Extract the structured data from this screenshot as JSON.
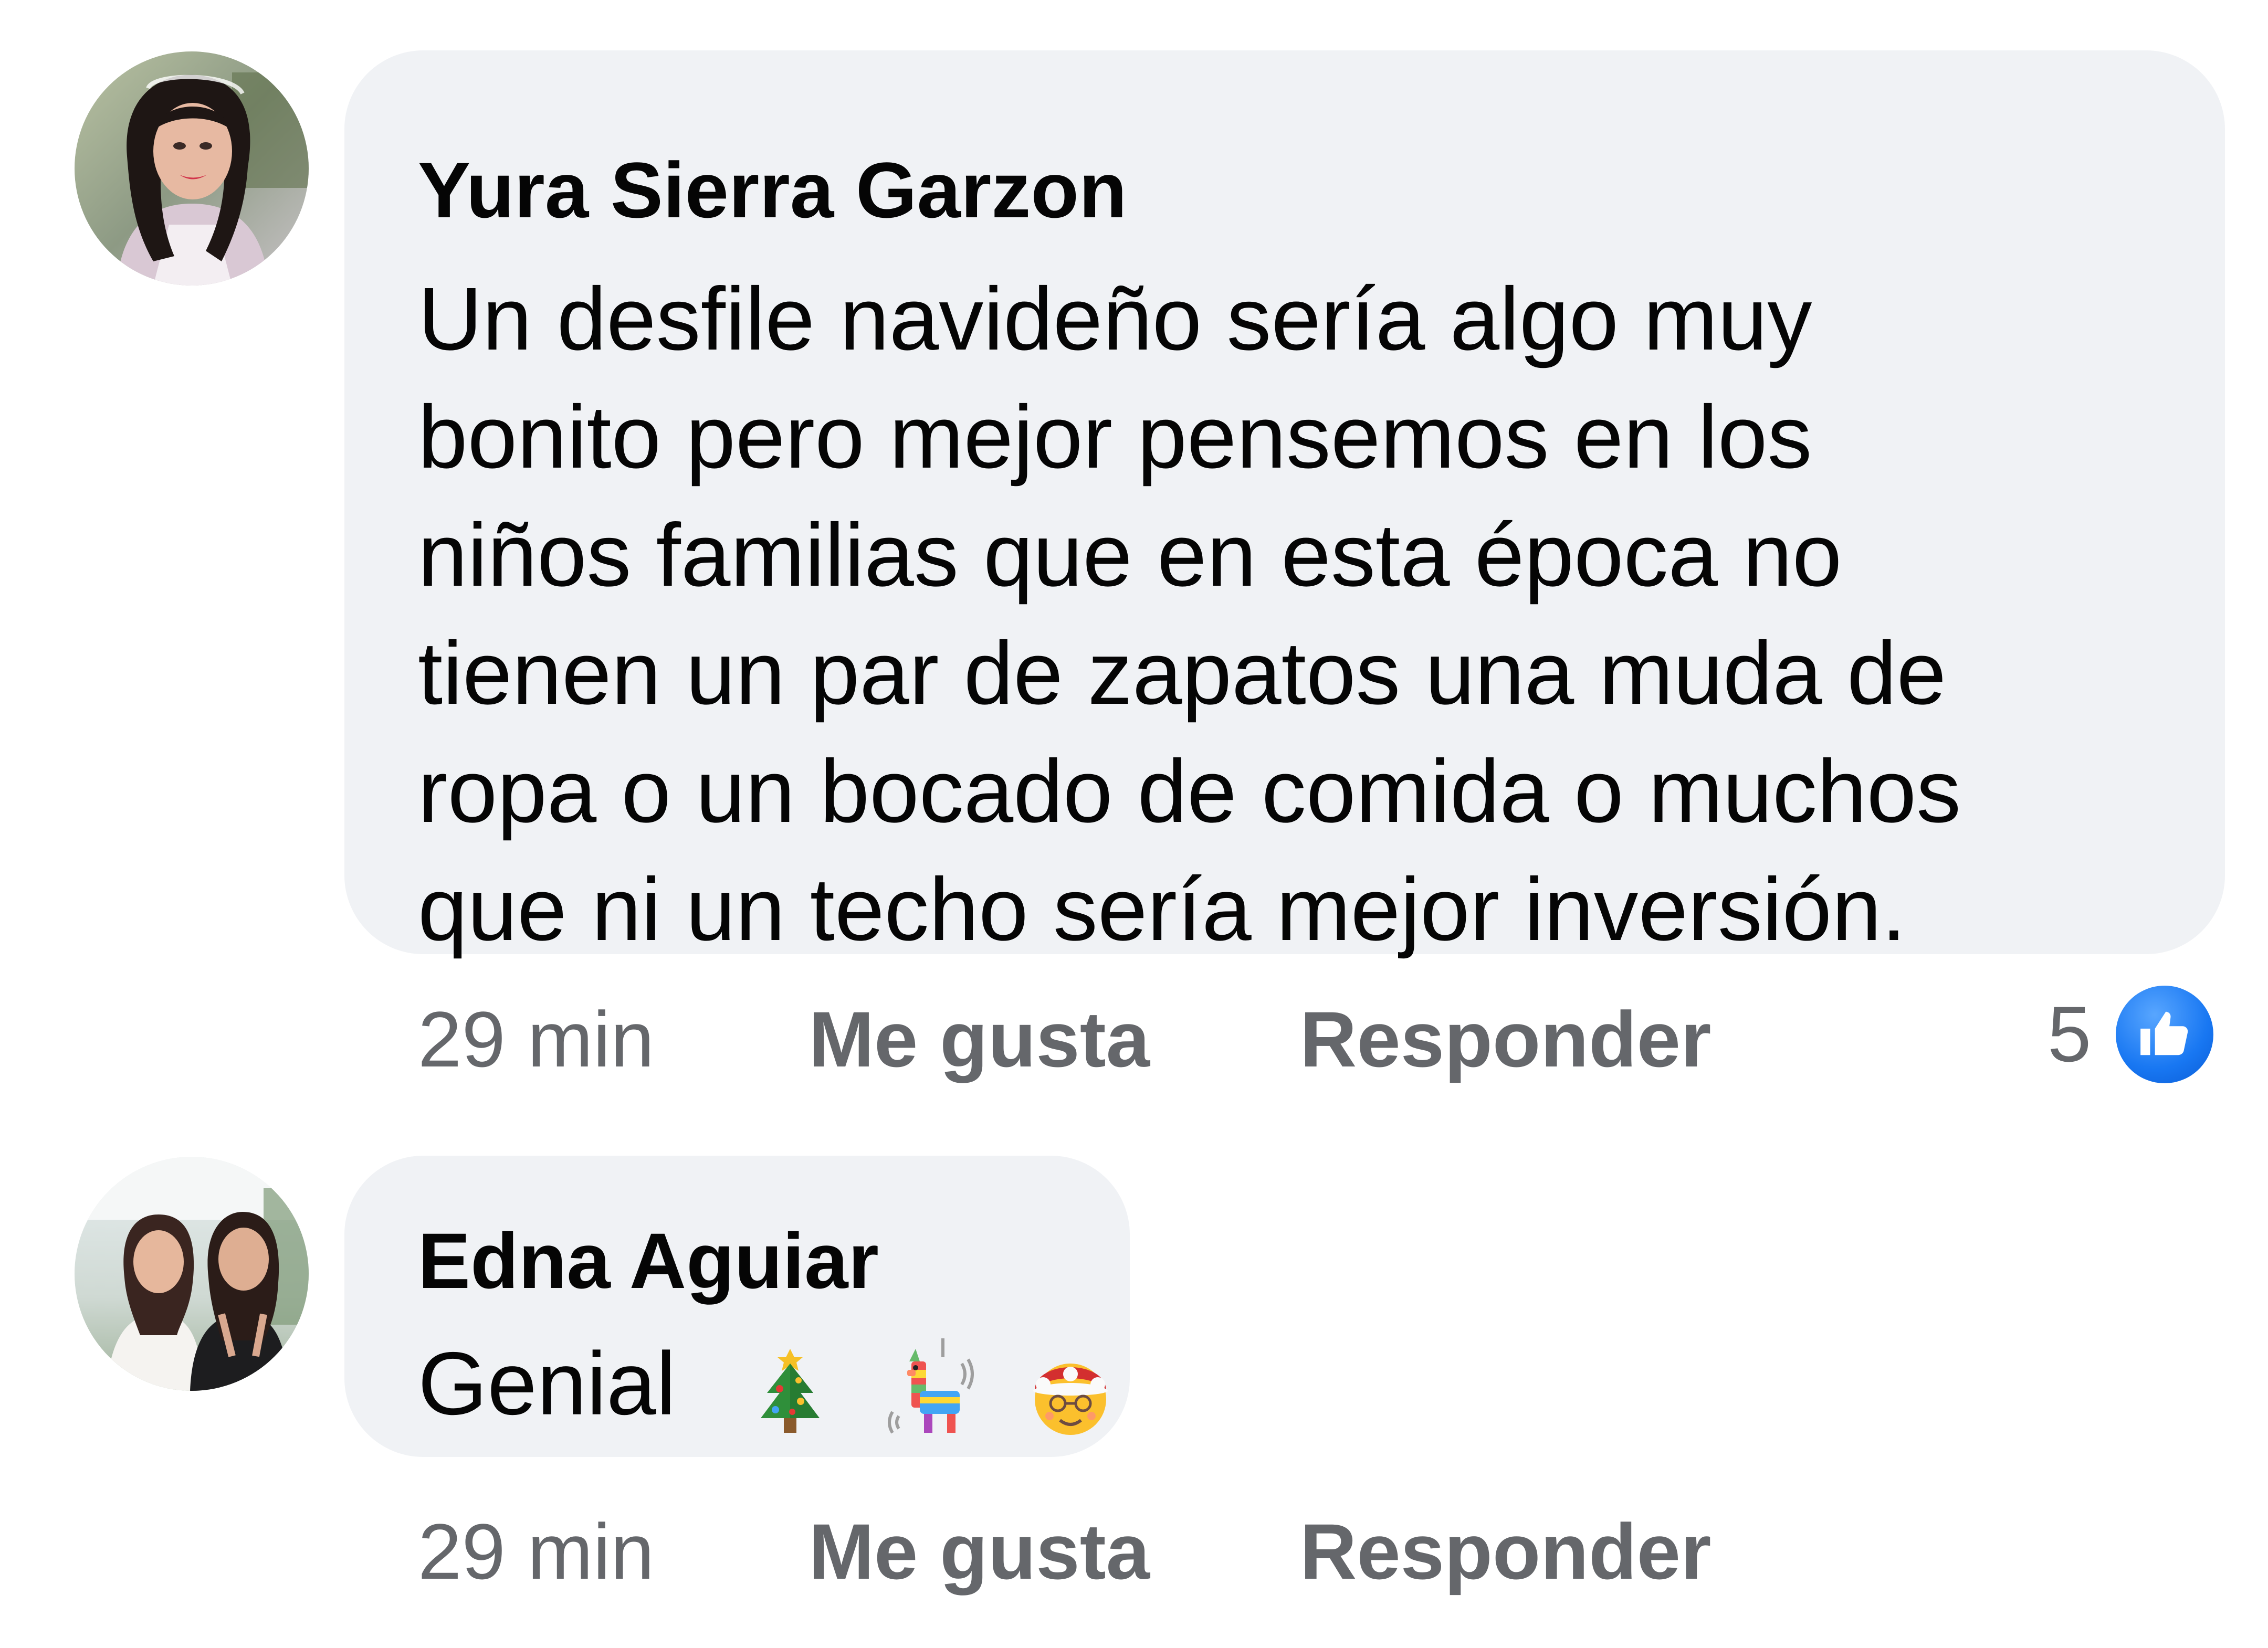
{
  "comments": [
    {
      "author": "Yura Sierra Garzon",
      "text_lines": [
        "Un desfile navideño sería algo muy",
        "bonito pero mejor pensemos en los",
        "niños familias que en esta época no",
        "tienen un par de zapatos una muda de",
        "ropa o un bocado de comida o muchos",
        "que ni un techo sería mejor inversión."
      ],
      "time": "29 min",
      "like_label": "Me gusta",
      "reply_label": "Responder",
      "reaction_count": "5",
      "reaction_icon": "like-thumb-icon"
    },
    {
      "author": "Edna Aguiar",
      "text": "Genial",
      "emojis": [
        "christmas-tree-icon",
        "pinata-icon",
        "mrs-claus-icon"
      ],
      "time": "29 min",
      "like_label": "Me gusta",
      "reply_label": "Responder"
    }
  ],
  "colors": {
    "bubble": "#f0f2f5",
    "meta_text": "#65676b",
    "like_blue": "#1877f2"
  }
}
